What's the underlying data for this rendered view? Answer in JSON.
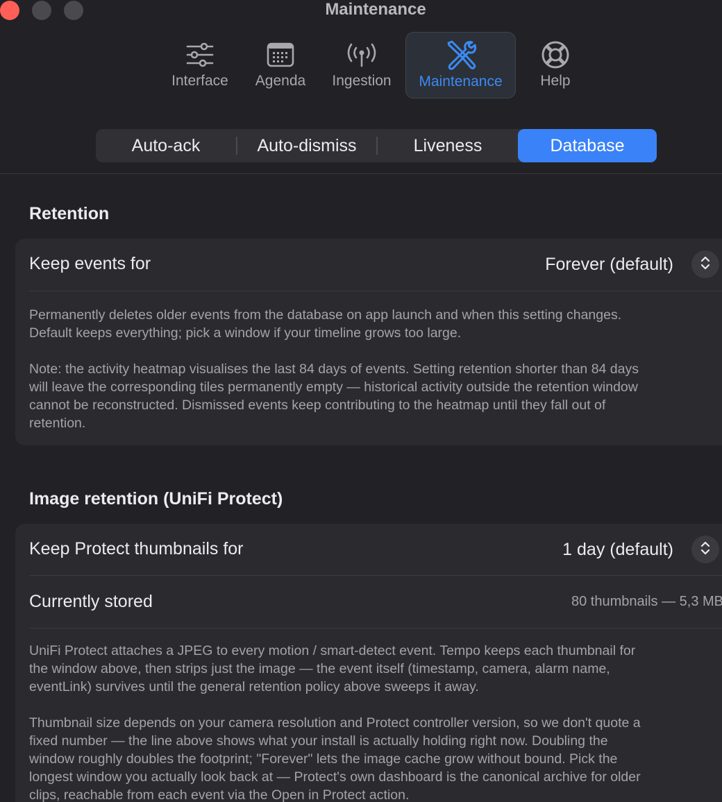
{
  "window": {
    "title": "Maintenance"
  },
  "toolbar": {
    "items": [
      {
        "label": "Interface",
        "icon": "sliders-icon"
      },
      {
        "label": "Agenda",
        "icon": "calendar-icon"
      },
      {
        "label": "Ingestion",
        "icon": "antenna-icon"
      },
      {
        "label": "Maintenance",
        "icon": "tools-icon",
        "selected": true
      },
      {
        "label": "Help",
        "icon": "lifebuoy-icon"
      }
    ],
    "accent": "#3b8bf4"
  },
  "tabs": {
    "items": [
      "Auto-ack",
      "Auto-dismiss",
      "Liveness",
      "Database"
    ],
    "selected": "Database"
  },
  "retention": {
    "title": "Retention",
    "keep_label": "Keep events for",
    "keep_value": "Forever (default)",
    "desc1_line1": "Permanently deletes older events from the database on app launch and when this setting changes.",
    "desc1_line2": "Default keeps everything; pick a window if your timeline grows too large.",
    "desc2_line1": "Note: the activity heatmap visualises the last 84 days of events. Setting retention shorter than 84 days",
    "desc2_line2": "will leave the corresponding tiles permanently empty — historical activity outside the retention window",
    "desc2_line3": "cannot be reconstructed. Dismissed events keep contributing to the heatmap until they fall out of",
    "desc2_line4": "retention."
  },
  "image_retention": {
    "title": "Image retention (UniFi Protect)",
    "keep_label": "Keep Protect thumbnails for",
    "keep_value": "1 day (default)",
    "stored_label": "Currently stored",
    "stored_value": "80 thumbnails — 5,3 MB",
    "desc1_line1": "UniFi Protect attaches a JPEG to every motion / smart-detect event. Tempo keeps each thumbnail for",
    "desc1_line2": "the window above, then strips just the image — the event itself (timestamp, camera, alarm name,",
    "desc1_line3": "eventLink) survives until the general retention policy above sweeps it away.",
    "desc2_line1": "Thumbnail size depends on your camera resolution and Protect controller version, so we don't quote a",
    "desc2_line2": "fixed number — the line above shows what your install is actually holding right now. Doubling the",
    "desc2_line3": "window roughly doubles the footprint; \"Forever\" lets the image cache grow without bound. Pick the",
    "desc2_line4": "longest window you actually look back at — Protect's own dashboard is the canonical archive for older",
    "desc2_line5": "clips, reachable from each event via the Open in Protect action."
  }
}
